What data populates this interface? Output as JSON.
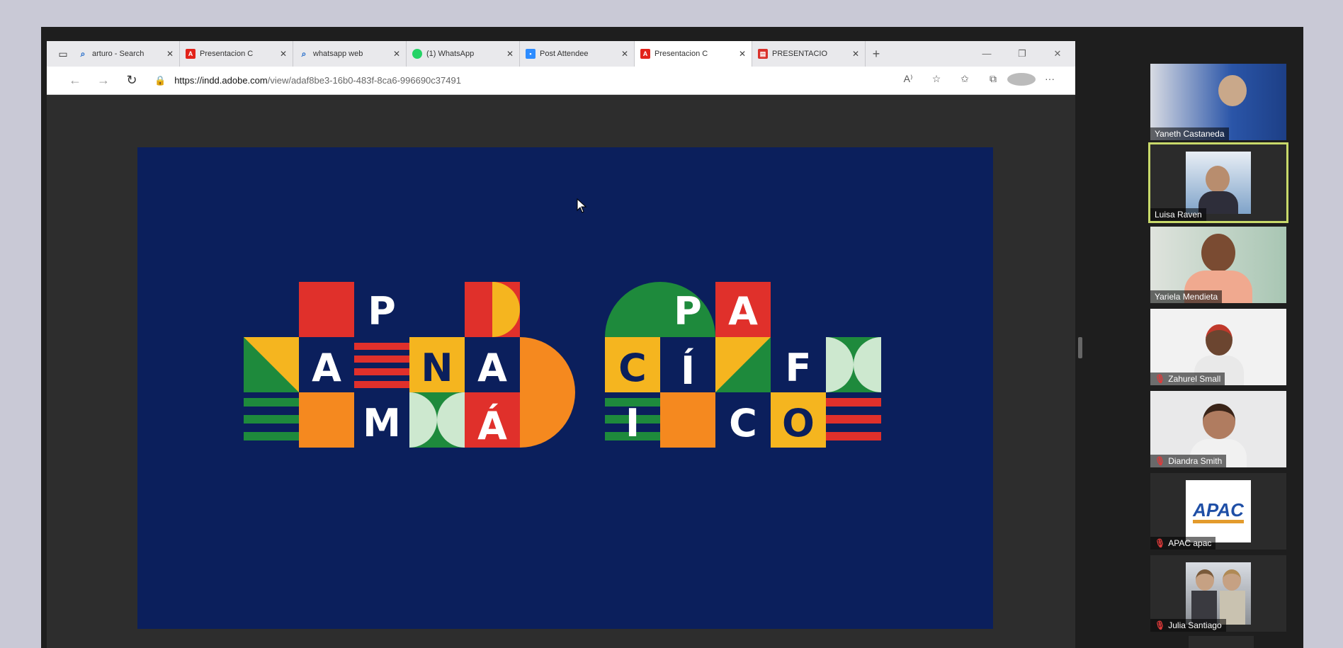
{
  "browser": {
    "tabs": [
      {
        "icon": "search-icon",
        "label": "arturo - Search",
        "active": false
      },
      {
        "icon": "adobe-icon",
        "label": "Presentacion C",
        "active": false
      },
      {
        "icon": "search-icon",
        "label": "whatsapp web",
        "active": false
      },
      {
        "icon": "whatsapp-icon",
        "label": "(1) WhatsApp",
        "active": false
      },
      {
        "icon": "zoom-icon",
        "label": "Post Attendee",
        "active": false
      },
      {
        "icon": "adobe-icon",
        "label": "Presentacion C",
        "active": true
      },
      {
        "icon": "pdf-icon",
        "label": "PRESENTACIO",
        "active": false
      }
    ],
    "url_host": "https://indd.adobe.com",
    "url_path": "/view/adaf8be3-16b0-483f-8ca6-996690c37491"
  },
  "slide": {
    "logo_left_letters": [
      "P",
      "A",
      "N",
      "A",
      "M",
      "Á"
    ],
    "logo_right_letters": [
      "P",
      "A",
      "C",
      "Í",
      "F",
      "I",
      "C",
      "O"
    ],
    "colors": {
      "background": "#0b1f5c",
      "red": "#e0302b",
      "orange": "#f5891f",
      "yellow": "#f5b51f",
      "green": "#1e8a3c",
      "mint": "#cde8cf",
      "white": "#ffffff"
    }
  },
  "participants": [
    {
      "name": "Yaneth Castaneda",
      "muted": false,
      "speaking": false
    },
    {
      "name": "Luisa Raven",
      "muted": false,
      "speaking": true
    },
    {
      "name": "Yariela Mendieta",
      "muted": false,
      "speaking": false
    },
    {
      "name": "Zahurel Small",
      "muted": true,
      "speaking": false
    },
    {
      "name": "Diandra Smith",
      "muted": true,
      "speaking": false
    },
    {
      "name": "APAC apac",
      "muted": true,
      "speaking": false
    },
    {
      "name": "Julia Santiago",
      "muted": true,
      "speaking": false
    }
  ],
  "apac_logo_text": "APAC"
}
